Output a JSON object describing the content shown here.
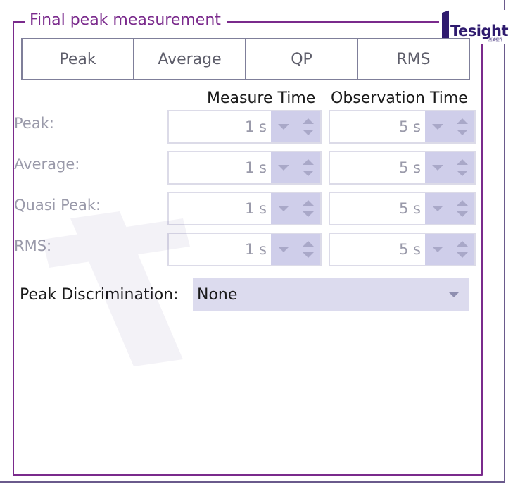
{
  "group": {
    "title": "Final peak measurement"
  },
  "logo": {
    "text": "Tesight",
    "subtext": "测试视界",
    "icon": "tesight-logo-icon"
  },
  "tabs": [
    {
      "label": "Peak"
    },
    {
      "label": "Average"
    },
    {
      "label": "QP"
    },
    {
      "label": "RMS"
    }
  ],
  "columns": {
    "measure_time": "Measure Time",
    "observation_time": "Observation Time"
  },
  "rows": [
    {
      "label": "Peak:",
      "measure_time": "1 s",
      "observation_time": "5 s"
    },
    {
      "label": "Average:",
      "measure_time": "1 s",
      "observation_time": "5 s"
    },
    {
      "label": "Quasi Peak:",
      "measure_time": "1 s",
      "observation_time": "5 s"
    },
    {
      "label": "RMS:",
      "measure_time": "1 s",
      "observation_time": "5 s"
    }
  ],
  "peak_discrimination": {
    "label": "Peak Discrimination:",
    "value": "None"
  },
  "colors": {
    "accent": "#7a2a8c",
    "spin_buttons": "#cfceea",
    "select_bg": "#dcdbee",
    "disabled_text": "#9a9aaa"
  }
}
